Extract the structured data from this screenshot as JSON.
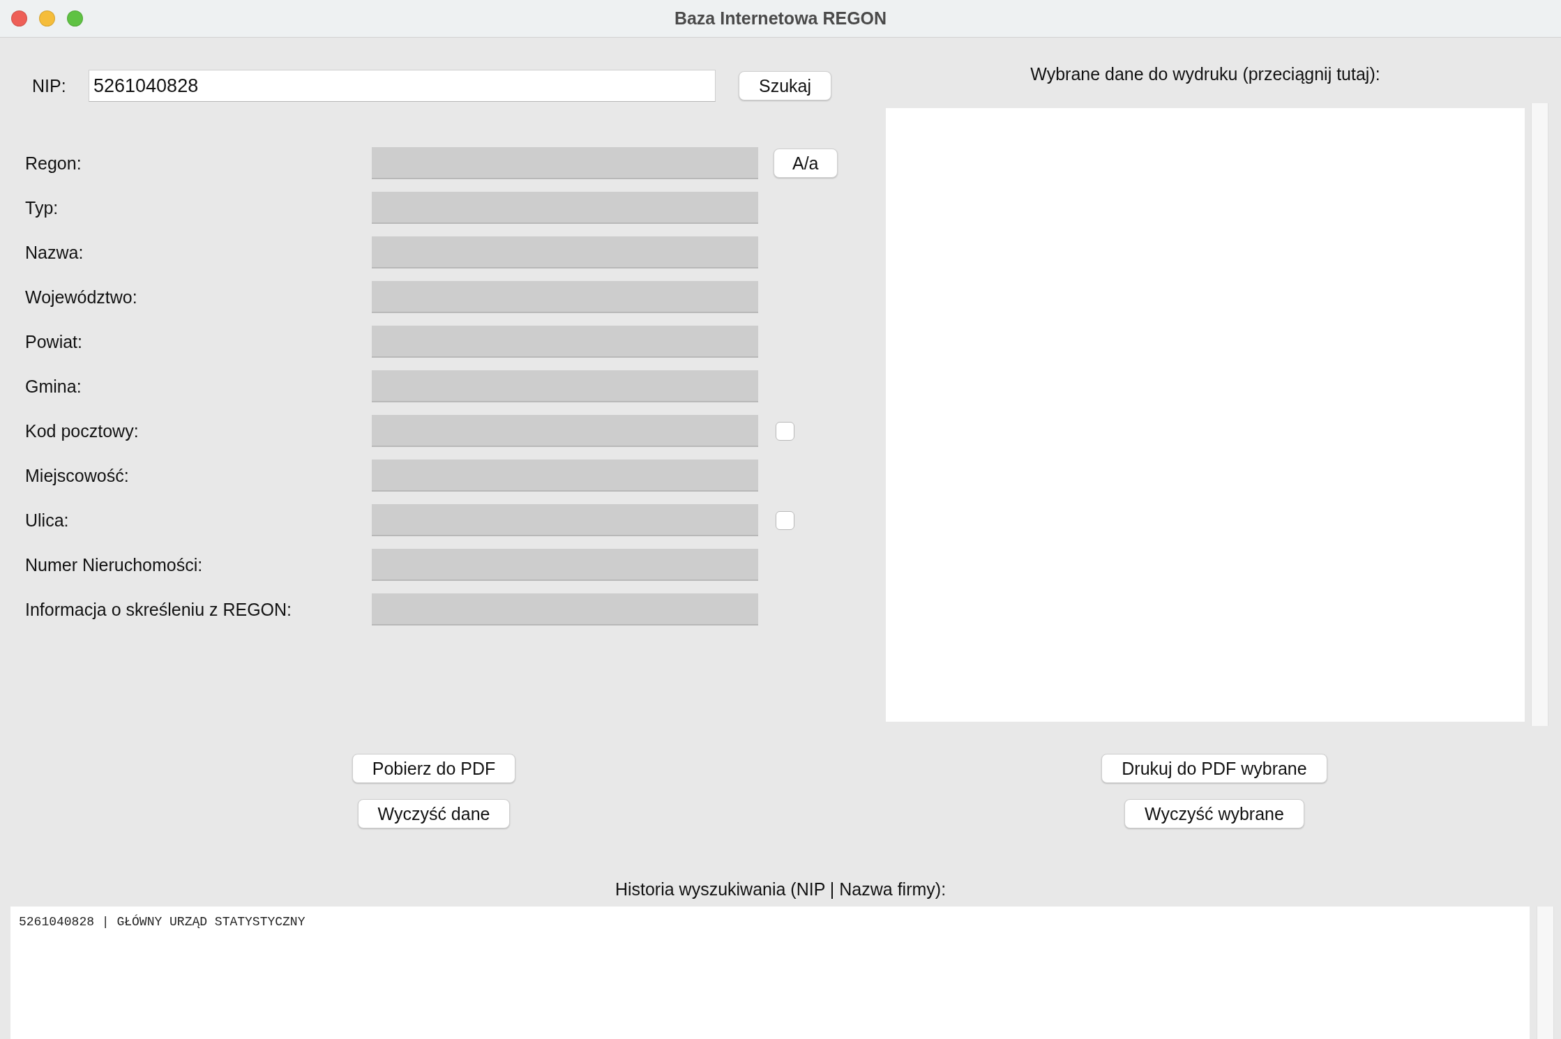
{
  "window": {
    "title": "Baza Internetowa REGON"
  },
  "nip": {
    "label": "NIP:",
    "value": "5261040828"
  },
  "search_button": "Szukaj",
  "fields": [
    {
      "label": "Regon:",
      "disabled": true,
      "accessory": {
        "kind": "button",
        "label": "A/a"
      }
    },
    {
      "label": "Typ:",
      "disabled": true
    },
    {
      "label": "Nazwa:",
      "disabled": true
    },
    {
      "label": "Województwo:",
      "disabled": true
    },
    {
      "label": "Powiat:",
      "disabled": true
    },
    {
      "label": "Gmina:",
      "disabled": true
    },
    {
      "label": "Kod pocztowy:",
      "disabled": true,
      "accessory": {
        "kind": "checkbox",
        "checked": false
      }
    },
    {
      "label": "Miejscowość:",
      "disabled": true
    },
    {
      "label": "Ulica:",
      "disabled": true,
      "accessory": {
        "kind": "checkbox",
        "checked": false
      }
    },
    {
      "label": "Numer Nieruchomości:",
      "disabled": true
    },
    {
      "label": "Informacja o skreśleniu z REGON:",
      "disabled": true
    }
  ],
  "selection_panel": {
    "title": "Wybrane dane do wydruku (przeciągnij tutaj):"
  },
  "left_buttons": [
    "Pobierz do PDF",
    "Wyczyść dane"
  ],
  "right_buttons": [
    "Drukuj do PDF wybrane",
    "Wyczyść wybrane"
  ],
  "history": {
    "title": "Historia wyszukiwania (NIP | Nazwa firmy):",
    "items": [
      "5261040828 | GŁÓWNY URZĄD STATYSTYCZNY"
    ]
  }
}
